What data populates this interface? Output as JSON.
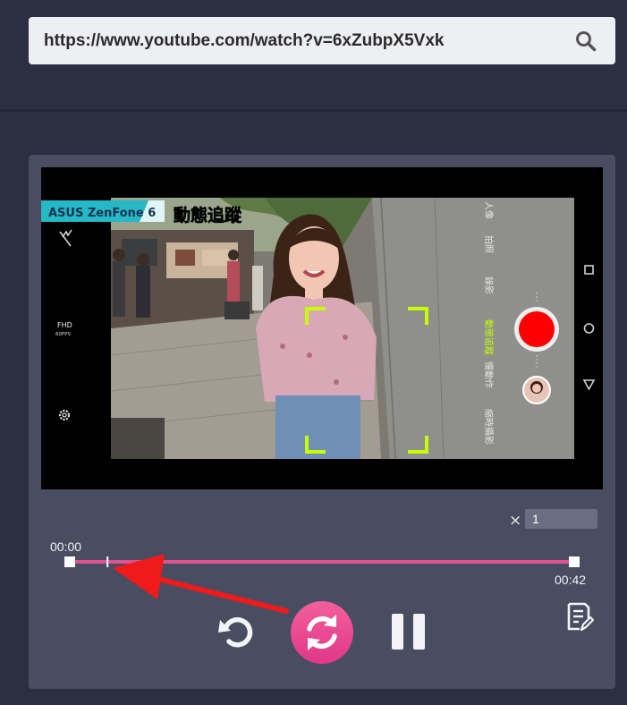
{
  "url_bar": {
    "value": "https://www.youtube.com/watch?v=6xZubpX5Vxk",
    "search_icon": "search-icon"
  },
  "video": {
    "brand_label": "ASUS ZenFone 6",
    "mode_title": "動態追蹤",
    "fhd_label": "FHD",
    "fps_label": "60FPS",
    "camera_modes": [
      "人像",
      "拍照",
      "錄影",
      "動態追蹤",
      "慢動作",
      "縮時攝影"
    ],
    "active_mode": "動態追蹤",
    "accent_color": "#c8ff00",
    "record_color": "#ff0000"
  },
  "speed": {
    "multiplier_symbol": "×",
    "value": "1"
  },
  "timeline": {
    "start_time": "00:00",
    "end_time": "00:42",
    "track_color": "#e0518f",
    "playhead_fraction": 0.073
  },
  "controls": {
    "reset_icon": "rotate-ccw-icon",
    "loop_icon": "refresh-icon",
    "pause_icon": "pause-icon",
    "notes_icon": "notes-icon",
    "loop_gradient": [
      "#f35f9a",
      "#e0378a"
    ]
  },
  "annotation": {
    "arrow_color": "#ef1a1a"
  }
}
